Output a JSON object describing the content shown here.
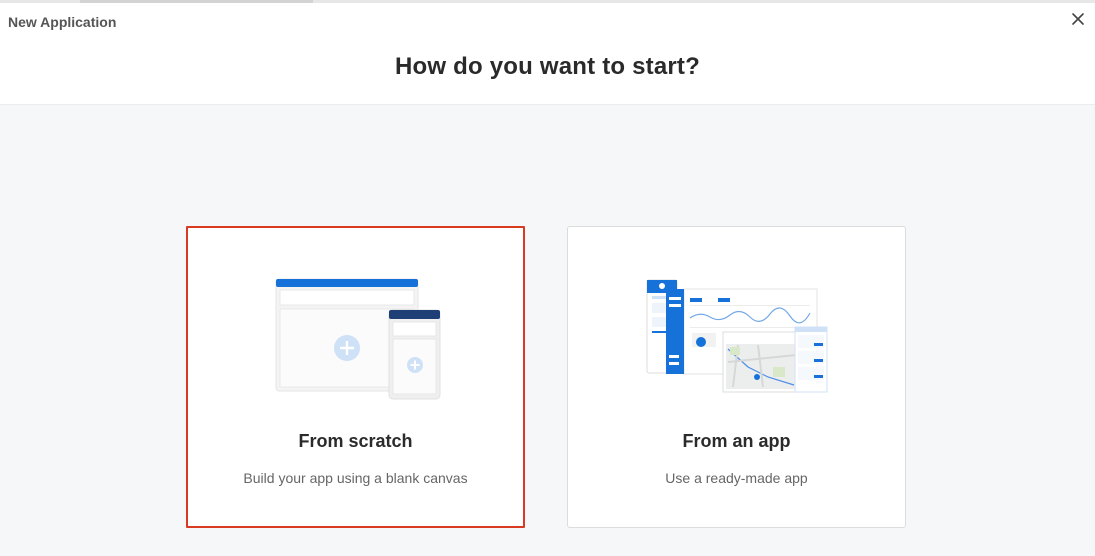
{
  "window": {
    "title": "New Application"
  },
  "dialog": {
    "heading": "How do you want to start?"
  },
  "options": [
    {
      "title": "From scratch",
      "description": "Build your app using a blank canvas",
      "selected": true
    },
    {
      "title": "From an app",
      "description": "Use a ready-made app",
      "selected": false
    }
  ],
  "icons": {
    "close": "close-icon",
    "scratch": "blank-canvas-illustration",
    "app": "app-template-illustration"
  },
  "colors": {
    "accent": "#1672d8",
    "selected_border": "#d83b22",
    "background": "#f6f7f9"
  }
}
